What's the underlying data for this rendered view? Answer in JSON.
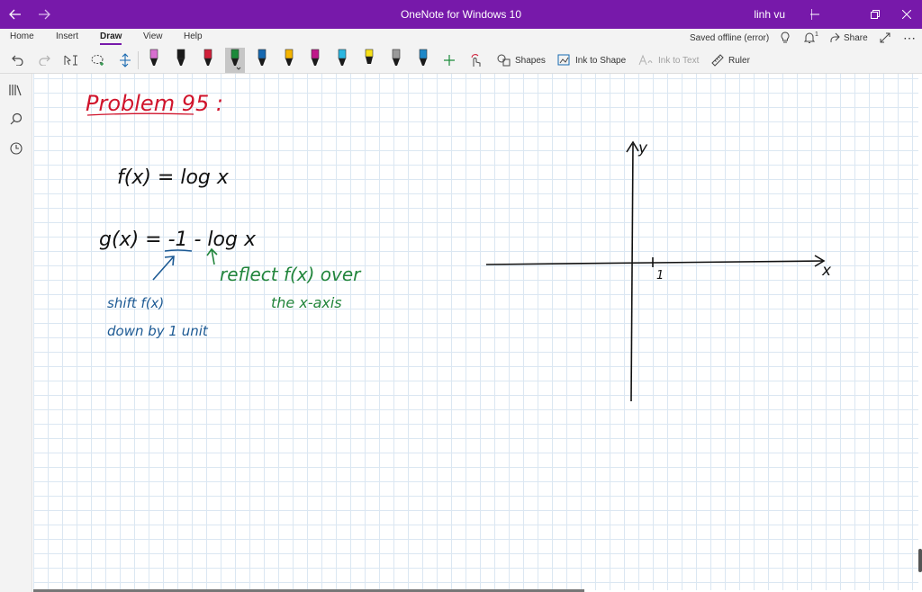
{
  "window": {
    "title": "OneNote for Windows 10",
    "user": "linh vu"
  },
  "ribbon": {
    "tabs": [
      {
        "label": "Home"
      },
      {
        "label": "Insert"
      },
      {
        "label": "Draw"
      },
      {
        "label": "View"
      },
      {
        "label": "Help"
      }
    ],
    "active_tab": "Draw",
    "status": "Saved offline (error)",
    "share_label": "Share",
    "notification_count": "1"
  },
  "toolbar": {
    "shapes_label": "Shapes",
    "ink_to_shape_label": "Ink to Shape",
    "ink_to_text_label": "Ink to Text",
    "ruler_label": "Ruler",
    "pens": [
      {
        "color": "#d86fd0"
      },
      {
        "color": "#1a1a1a"
      },
      {
        "color": "#d1203a"
      },
      {
        "color": "#1b8a3a"
      },
      {
        "color": "#1668b0"
      },
      {
        "color": "#f4b400"
      },
      {
        "color": "#c0188a"
      },
      {
        "color": "#2ab6e0"
      },
      {
        "color": "#f7e018"
      },
      {
        "color": "#9a9a9a"
      },
      {
        "color": "#1e88c8"
      }
    ],
    "selected_pen": 3
  },
  "note": {
    "title": "Problem 95 :",
    "f_expr": "f(x) = log x",
    "g_expr": "g(x) = -1 - log x",
    "annotation_shift_line1": "shift f(x)",
    "annotation_shift_line2": "down by 1 unit",
    "annotation_reflect_line1": "reflect  f(x)  over",
    "annotation_reflect_line2": "the  x-axis",
    "axis_x_label": "x",
    "axis_y_label": "y",
    "axis_tick_label": "1"
  },
  "colors": {
    "title_bar": "#7719aa",
    "ink_red": "#d0142c",
    "ink_black": "#111111",
    "ink_blue": "#1d5a94",
    "ink_green": "#22853c"
  }
}
